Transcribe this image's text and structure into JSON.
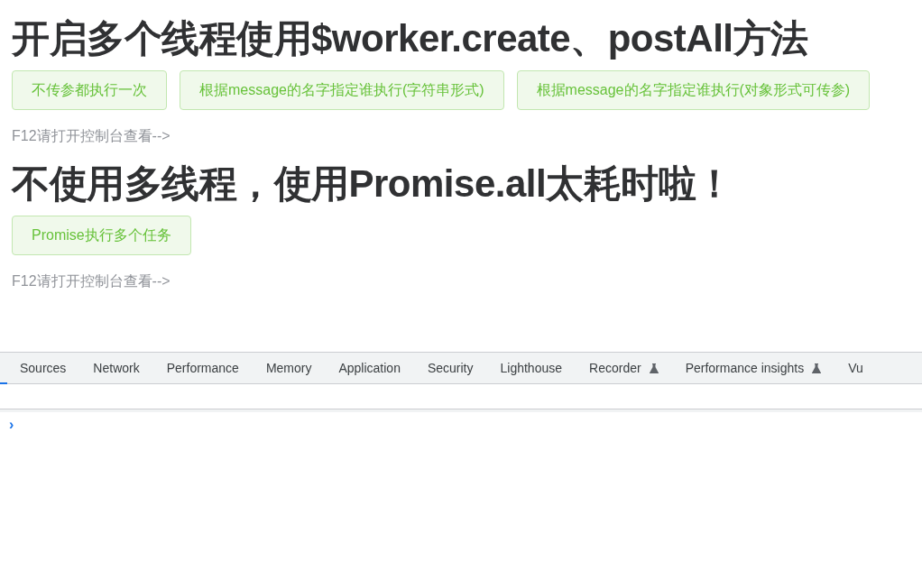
{
  "sections": [
    {
      "heading": "开启多个线程使用$worker.create、postAll方法",
      "buttons": [
        "不传参都执行一次",
        "根据message的名字指定谁执行(字符串形式)",
        "根据message的名字指定谁执行(对象形式可传参)"
      ],
      "hint": "F12请打开控制台查看-->"
    },
    {
      "heading": "不使用多线程，使用Promise.all太耗时啦！",
      "buttons": [
        "Promise执行多个任务"
      ],
      "hint": "F12请打开控制台查看-->"
    }
  ],
  "devtools": {
    "tabs": [
      {
        "label": "Sources",
        "experimental": false
      },
      {
        "label": "Network",
        "experimental": false
      },
      {
        "label": "Performance",
        "experimental": false
      },
      {
        "label": "Memory",
        "experimental": false
      },
      {
        "label": "Application",
        "experimental": false
      },
      {
        "label": "Security",
        "experimental": false
      },
      {
        "label": "Lighthouse",
        "experimental": false
      },
      {
        "label": "Recorder",
        "experimental": true
      },
      {
        "label": "Performance insights",
        "experimental": true
      },
      {
        "label": "Vu",
        "experimental": false
      }
    ],
    "prompt": "›"
  }
}
